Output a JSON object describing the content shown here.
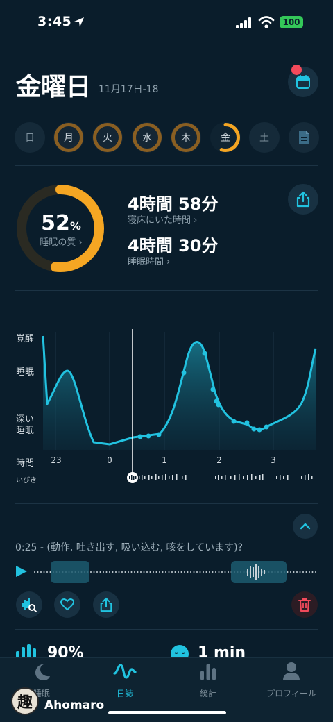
{
  "status_bar": {
    "time": "3:45",
    "battery": "100"
  },
  "header": {
    "title": "金曜日",
    "date_range": "11月17日-18"
  },
  "days": [
    {
      "label": "日",
      "state": "empty"
    },
    {
      "label": "月",
      "state": "ring"
    },
    {
      "label": "火",
      "state": "ring"
    },
    {
      "label": "水",
      "state": "ring"
    },
    {
      "label": "木",
      "state": "ring"
    },
    {
      "label": "金",
      "state": "selected"
    },
    {
      "label": "土",
      "state": "empty"
    }
  ],
  "summary": {
    "quality_value": "52",
    "quality_unit": "%",
    "quality_label": "睡眠の質 ›",
    "quality_fraction": 0.52,
    "time_in_bed": "4時間 58分",
    "time_in_bed_label": "寝床にいた時間 ›",
    "sleep_time": "4時間 30分",
    "sleep_time_label": "睡眠時間 ›"
  },
  "chart_data": {
    "type": "area",
    "y_categories": [
      "覚醒",
      "睡眠",
      "深い睡眠"
    ],
    "x_tick_labels": [
      "23",
      "0",
      "1",
      "2",
      "3"
    ],
    "x_axis_label": "時間",
    "snore_row_label": "いびき"
  },
  "recording": {
    "caption": "0:25 - (動作, 吐き出す, 吸い込む, 咳をしています)?"
  },
  "stats": {
    "stat1": "90%",
    "stat2": "1 min"
  },
  "tabs": [
    {
      "label": "睡眠",
      "icon": "moon-icon",
      "active": false
    },
    {
      "label": "日誌",
      "icon": "wave-icon",
      "active": true
    },
    {
      "label": "統計",
      "icon": "bars-icon",
      "active": false
    },
    {
      "label": "プロフィール",
      "icon": "person-icon",
      "active": false
    }
  ],
  "user": {
    "avatar_char": "趣",
    "name": "Ahomaro"
  },
  "colors": {
    "accent": "#21c3e0",
    "orange": "#f5a623",
    "background": "#0a1d2b",
    "delete": "#f24a5b"
  }
}
